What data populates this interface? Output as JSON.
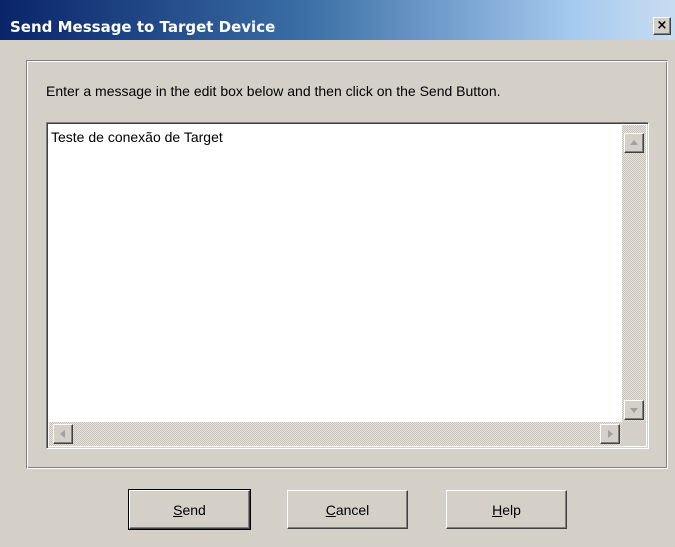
{
  "window": {
    "title": "Send Message to Target Device",
    "close_glyph": "×"
  },
  "dialog": {
    "instruction": "Enter a message in the edit box below and then click on the Send Button.",
    "message_value": "Teste de conexão de Target"
  },
  "buttons": {
    "send": {
      "mnemonic": "S",
      "rest": "end"
    },
    "cancel": {
      "mnemonic": "C",
      "rest": "ancel"
    },
    "help": {
      "mnemonic": "H",
      "rest": "elp"
    }
  },
  "colors": {
    "face": "#d4d0c8",
    "title_start": "#0a246a",
    "title_end": "#a6caf0"
  }
}
